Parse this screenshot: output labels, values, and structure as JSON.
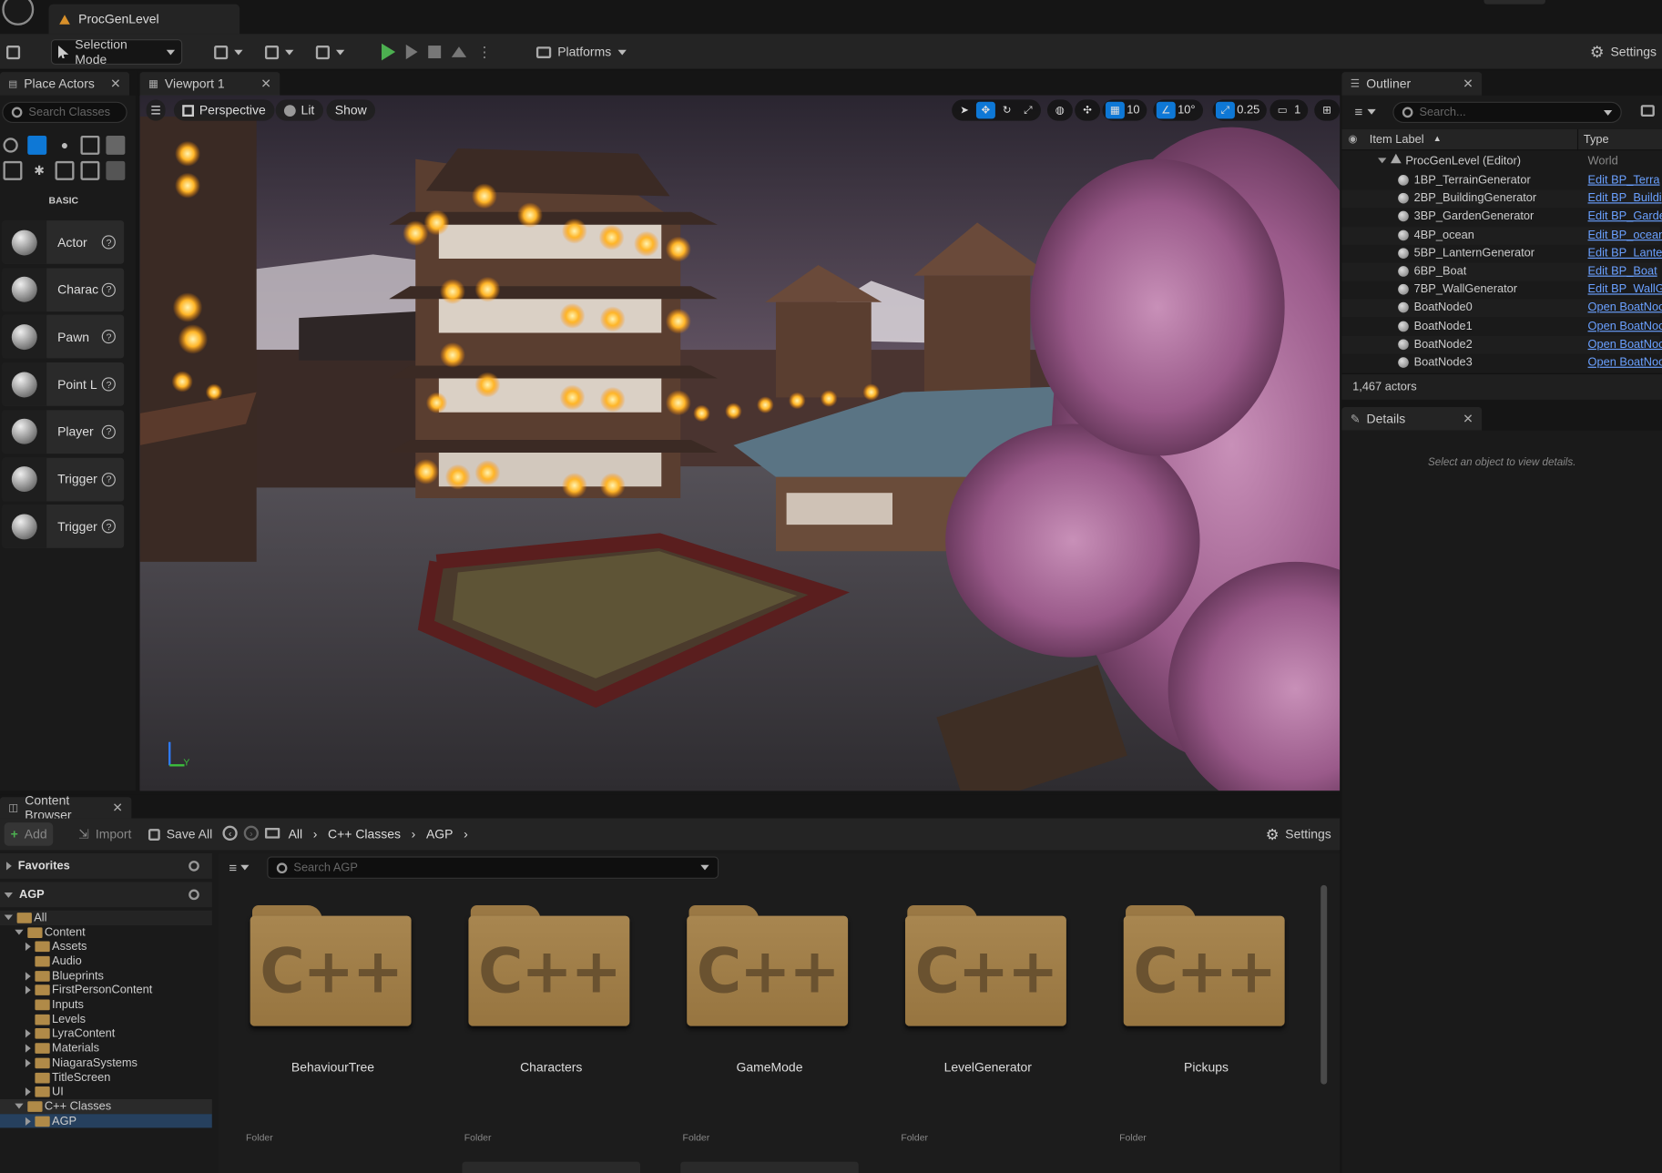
{
  "window": {
    "tab_title": "ProcGenLevel"
  },
  "toolbar": {
    "selection_mode": "Selection Mode",
    "platforms": "Platforms",
    "settings": "Settings"
  },
  "place_actors": {
    "tab": "Place Actors",
    "search_placeholder": "Search Classes",
    "category": "BASIC",
    "items": [
      {
        "label": "Actor",
        "icon": "sphere-icon"
      },
      {
        "label": "Charac",
        "icon": "character-icon"
      },
      {
        "label": "Pawn",
        "icon": "pawn-icon"
      },
      {
        "label": "Point L",
        "icon": "point-light-icon"
      },
      {
        "label": "Player",
        "icon": "player-start-icon"
      },
      {
        "label": "Trigger",
        "icon": "trigger-box-icon"
      },
      {
        "label": "Trigger",
        "icon": "trigger-sphere-icon"
      }
    ]
  },
  "viewport": {
    "tab": "Viewport 1",
    "perspective": "Perspective",
    "lit": "Lit",
    "show": "Show",
    "grid_snap": "10",
    "rotation_snap": "10°",
    "scale_snap": "0.25",
    "camera_speed": "1"
  },
  "outliner": {
    "tab": "Outliner",
    "search_placeholder": "Search...",
    "col_label": "Item Label",
    "col_type": "Type",
    "root": {
      "label": "ProcGenLevel (Editor)",
      "type": "World"
    },
    "rows": [
      {
        "label": "1BP_TerrainGenerator",
        "type": "Edit BP_Terra"
      },
      {
        "label": "2BP_BuildingGenerator",
        "type": "Edit BP_Buildi"
      },
      {
        "label": "3BP_GardenGenerator",
        "type": "Edit BP_Garde"
      },
      {
        "label": "4BP_ocean",
        "type": "Edit BP_ocean"
      },
      {
        "label": "5BP_LanternGenerator",
        "type": "Edit BP_Lante"
      },
      {
        "label": "6BP_Boat",
        "type": "Edit BP_Boat"
      },
      {
        "label": "7BP_WallGenerator",
        "type": "Edit BP_WallG"
      },
      {
        "label": "BoatNode0",
        "type": "Open BoatNoc"
      },
      {
        "label": "BoatNode1",
        "type": "Open BoatNoc"
      },
      {
        "label": "BoatNode2",
        "type": "Open BoatNoc"
      },
      {
        "label": "BoatNode3",
        "type": "Open BoatNoc"
      }
    ],
    "count": "1,467 actors"
  },
  "details": {
    "tab": "Details",
    "empty": "Select an object to view details."
  },
  "content_browser": {
    "tab": "Content Browser",
    "add": "Add",
    "import": "Import",
    "save_all": "Save All",
    "breadcrumb": [
      "All",
      "C++ Classes",
      "AGP"
    ],
    "settings": "Settings",
    "favorites": "Favorites",
    "project": "AGP",
    "search_placeholder": "Search AGP",
    "tree": [
      {
        "label": "All",
        "level": 0,
        "expanded": true
      },
      {
        "label": "Content",
        "level": 1,
        "expanded": true
      },
      {
        "label": "Assets",
        "level": 2,
        "expander": true
      },
      {
        "label": "Audio",
        "level": 2,
        "expander": false
      },
      {
        "label": "Blueprints",
        "level": 2,
        "expander": true
      },
      {
        "label": "FirstPersonContent",
        "level": 2,
        "expander": true
      },
      {
        "label": "Inputs",
        "level": 2,
        "expander": false
      },
      {
        "label": "Levels",
        "level": 2,
        "expander": false
      },
      {
        "label": "LyraContent",
        "level": 2,
        "expander": true
      },
      {
        "label": "Materials",
        "level": 2,
        "expander": true
      },
      {
        "label": "NiagaraSystems",
        "level": 2,
        "expander": true
      },
      {
        "label": "TitleScreen",
        "level": 2,
        "expander": false
      },
      {
        "label": "UI",
        "level": 2,
        "expander": true
      },
      {
        "label": "C++ Classes",
        "level": 1,
        "expanded": true
      },
      {
        "label": "AGP",
        "level": 2,
        "expander": true,
        "selected": true
      }
    ],
    "folders": [
      {
        "name": "BehaviourTree",
        "kind": "Folder",
        "glyph": "C++"
      },
      {
        "name": "Characters",
        "kind": "Folder",
        "glyph": "C++"
      },
      {
        "name": "GameMode",
        "kind": "Folder",
        "glyph": "C++"
      },
      {
        "name": "LevelGenerator",
        "kind": "Folder",
        "glyph": "C++"
      },
      {
        "name": "Pickups",
        "kind": "Folder",
        "glyph": "C++"
      }
    ]
  },
  "colors": {
    "accent": "#0e78d6",
    "play": "#4caf50",
    "link": "#6aa0ff",
    "folder": "#a88650"
  }
}
